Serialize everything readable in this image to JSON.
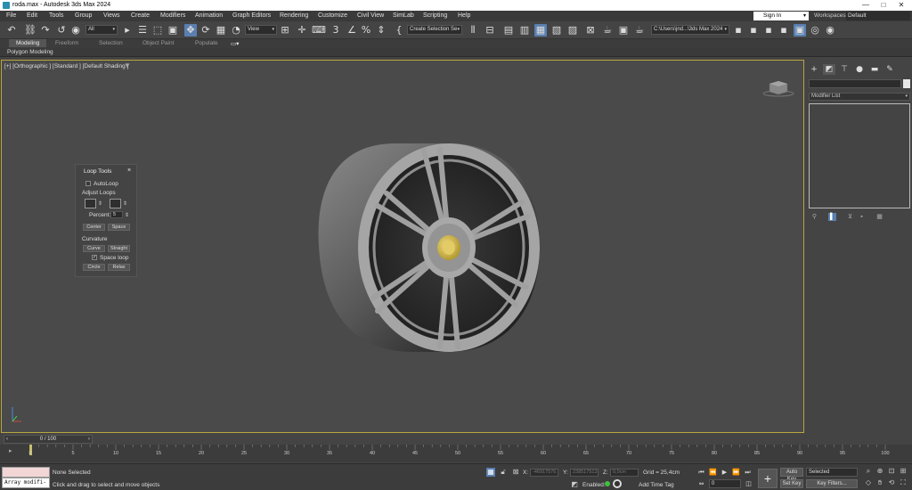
{
  "window": {
    "title": "roda.max - Autodesk 3ds Max 2024",
    "minimize": "—",
    "maximize": "□",
    "close": "✕"
  },
  "menu": {
    "items": [
      "File",
      "Edit",
      "Tools",
      "Group",
      "Views",
      "Create",
      "Modifiers",
      "Animation",
      "Graph Editors",
      "Rendering",
      "Customize",
      "Civil View",
      "SimLab",
      "Scripting",
      "Help"
    ],
    "signin": "Sign In",
    "workspaces_label": "Workspaces:",
    "workspace_value": "Default"
  },
  "toolbar": {
    "selection_filter": "All",
    "reference_coord": "View",
    "named_selection": "Create Selection Se",
    "project_path": "C:\\Users\\jnd...\\3ds Max 2024"
  },
  "ribbon": {
    "tabs": [
      "Modeling",
      "Freeform",
      "Selection",
      "Object Paint",
      "Populate"
    ],
    "active_tab": "Modeling",
    "panel": "Polygon Modeling"
  },
  "viewport": {
    "label": "[+] [Orthographic ] [Standard ] [Default Shading ]"
  },
  "loop_tools": {
    "title": "Loop Tools",
    "close": "×",
    "autoloop": "AutoLoop",
    "adjust_loops": "Adjust Loops",
    "percent_label": "Percent:",
    "percent_value": "5",
    "center": "Center",
    "space": "Space",
    "curvature": "Curvature",
    "curve": "Curve",
    "straight": "Straight",
    "space_loop": "Space loop",
    "circle": "Circle",
    "relax": "Relax"
  },
  "command_panel": {
    "modifier_list": "Modifier List"
  },
  "timeline": {
    "slider": "0 / 100",
    "ticks": [
      "0",
      "5",
      "10",
      "15",
      "20",
      "25",
      "30",
      "35",
      "40",
      "45",
      "50",
      "55",
      "60",
      "65",
      "70",
      "75",
      "80",
      "85",
      "90",
      "95",
      "100"
    ]
  },
  "status": {
    "maxscript_output": "Array modifi-",
    "selection": "None Selected",
    "prompt": "Click and drag to select and move objects",
    "x_label": "X:",
    "x_value": "-46917576",
    "y_label": "Y:",
    "y_value": "238517513",
    "z_label": "Z:",
    "z_value": "0,0cm",
    "grid": "Grid = 25,4cm",
    "enabled": "Enabled:",
    "add_time_tag": "Add Time Tag",
    "auto_key": "Auto Key",
    "set_key": "Set Key",
    "selected": "Selected",
    "key_filters": "Key Filters...",
    "frame": "0"
  },
  "colors": {
    "viewport_bg": "#4a4a4a",
    "accent_blue": "#5a7fb0",
    "viewport_border": "#b8a640",
    "wheel_center": "#d4b84a"
  }
}
